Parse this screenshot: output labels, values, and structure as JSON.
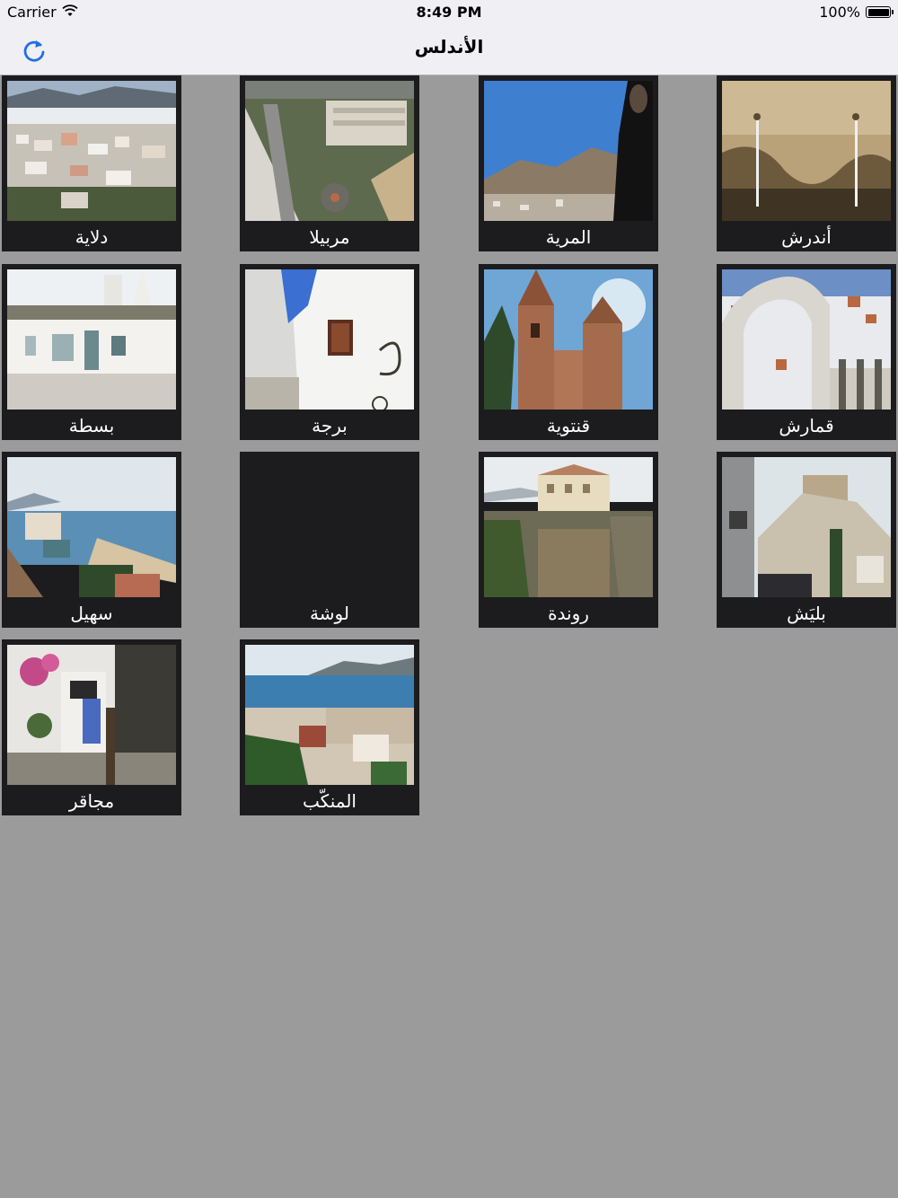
{
  "status_bar": {
    "carrier": "Carrier",
    "time": "8:49 PM",
    "battery": "100%"
  },
  "nav": {
    "title": "الأندلس",
    "refresh_icon": "refresh-icon",
    "accent_color": "#1e6fe6"
  },
  "tiles": [
    {
      "label": "دلاية",
      "image": "town-hillside"
    },
    {
      "label": "مربيلا",
      "image": "aerial-city-boulevard"
    },
    {
      "label": "المرية",
      "image": "city-overlook-photographer"
    },
    {
      "label": "أندرش",
      "image": "stone-fountain"
    },
    {
      "label": "بسطة",
      "image": "cave-house"
    },
    {
      "label": "برجة",
      "image": "whitewashed-wall-window"
    },
    {
      "label": "قنتوية",
      "image": "church-towers"
    },
    {
      "label": "قمارش",
      "image": "white-village-through-arch"
    },
    {
      "label": "سهيل",
      "image": "coastal-beach-town"
    },
    {
      "label": "لوشة",
      "image": "blank"
    },
    {
      "label": "روندة",
      "image": "cliff-top-buildings"
    },
    {
      "label": "بليَش",
      "image": "castle-on-hill"
    },
    {
      "label": "مجاقر",
      "image": "narrow-street-flowers"
    },
    {
      "label": "المنكّب",
      "image": "coastal-bay-town"
    }
  ]
}
